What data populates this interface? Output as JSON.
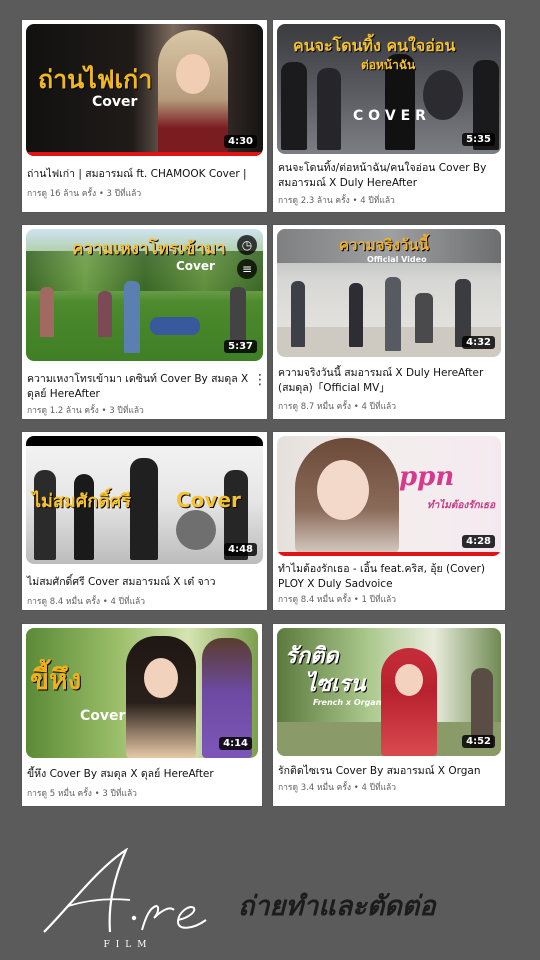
{
  "videos": [
    {
      "title": "ถ่านไฟเก่า | สมอารมณ์ ft. CHAMOOK Cover |",
      "meta": "การดู 16 ล้าน ครั้ง • 3 ปีที่แล้ว",
      "duration": "4:30",
      "overlay_title": "ถ่านไฟเก่า",
      "overlay_sub": "Cover"
    },
    {
      "title": "คนจะโดนทิ้ง/ต่อหน้าฉัน/คนใจอ่อน Cover By สมอารมณ์ X Duly HereAfter",
      "meta": "การดู 2.3 ล้าน ครั้ง • 4 ปีที่แล้ว",
      "duration": "5:35",
      "overlay_title": "คนจะโดนทิ้ง คนใจอ่อน",
      "overlay_title2": "ต่อหน้าฉัน",
      "overlay_sub": "C O V E R"
    },
    {
      "title": "ความเหงาโทรเข้ามา เดซินท์ Cover By สมดุล X ดุลย์ HereAfter",
      "meta": "การดู 1.2 ล้าน ครั้ง • 3 ปีที่แล้ว",
      "duration": "5:37",
      "overlay_title": "ความเหงาโทรเข้ามา",
      "overlay_sub": "Cover"
    },
    {
      "title": "ความจริงวันนี้ สมอารมณ์ X Duly HereAfter (สมดุล)「Official MV」",
      "meta": "การดู 8.7 หมื่น ครั้ง • 4 ปีที่แล้ว",
      "duration": "4:32",
      "overlay_title": "ความจริงวันนี้",
      "overlay_sub": "Official Video"
    },
    {
      "title": "ไม่สมศักดิ์ศรี Cover สมอารมณ์ X เต๋ จาว",
      "meta": "การดู 8.4 หมื่น ครั้ง • 4 ปีที่แล้ว",
      "duration": "4:48",
      "overlay_title": "ไม่สมศักดิ์ศรี",
      "overlay_sub": "Cover"
    },
    {
      "title": "ทำไมต้องรักเธอ - เอิ้น feat.คริส, อุ้ย (Cover) PLOY X Duly Sadvoice",
      "meta": "การดู 8.4 หมื่น ครั้ง • 1 ปีที่แล้ว",
      "duration": "4:28",
      "overlay_title": "ppn",
      "overlay_sub": "ทำไมต้องรักเธอ"
    },
    {
      "title": "ขี้หึง Cover By สมดุล X ดุลย์ HereAfter",
      "meta": "การดู 5 หมื่น ครั้ง • 3 ปีที่แล้ว",
      "duration": "4:14",
      "overlay_title": "ขี้หึง",
      "overlay_sub": "Cover"
    },
    {
      "title": "รักติดไซเรน Cover By สมอารมณ์ X Organ",
      "meta": "การดู 3.4 หมื่น ครั้ง • 4 ปีที่แล้ว",
      "duration": "4:52",
      "overlay_title": "รักติด",
      "overlay_title2": "ไซเรน",
      "overlay_sub": "French x Organ"
    }
  ],
  "menu_glyph": "⋮",
  "brand": {
    "logo_text": "A·re",
    "sub": "FILM"
  },
  "credit": "ถ่ายทำและตัดต่อ",
  "colors": {
    "background": "#5b5b5b",
    "progress": "#e01414",
    "card": "#ffffff"
  }
}
